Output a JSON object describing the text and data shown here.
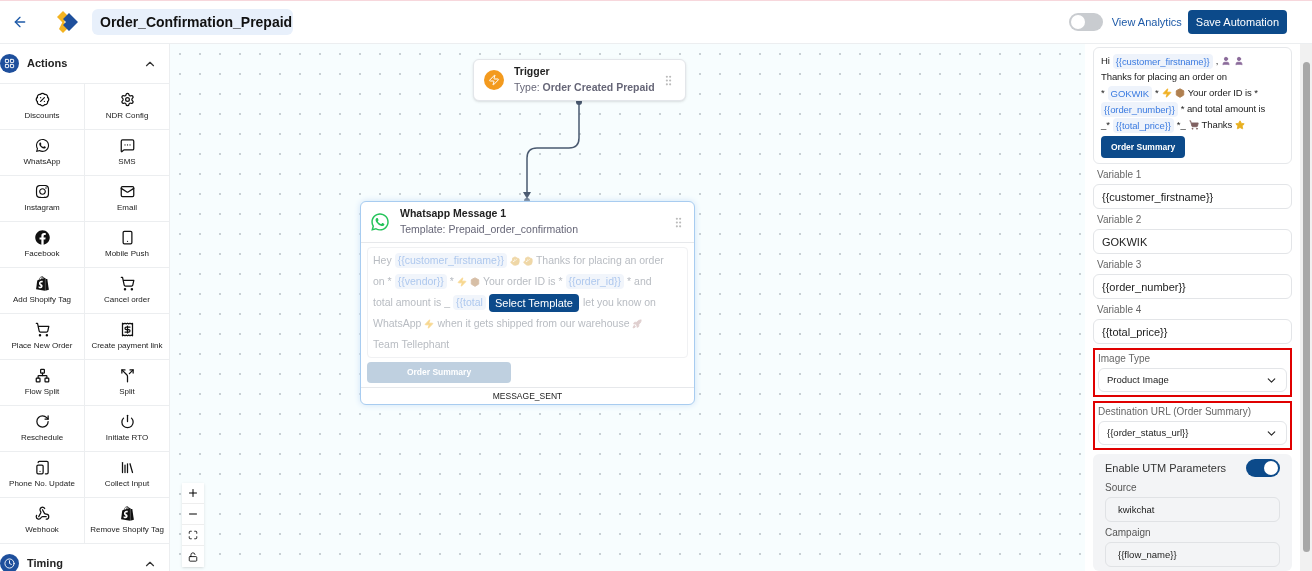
{
  "header": {
    "title": "Order_Confirmation_Prepaid",
    "analytics": {
      "label": "View Analytics",
      "on": false
    },
    "save_button": "Save Automation"
  },
  "sidebar": {
    "sections": [
      {
        "title": "Actions",
        "expanded": true,
        "items": [
          "Discounts",
          "NDR Config",
          "WhatsApp",
          "SMS",
          "Instagram",
          "Email",
          "Facebook",
          "Mobile Push",
          "Add Shopify Tag",
          "Cancel order",
          "Place New Order",
          "Create payment link",
          "Flow Split",
          "Split",
          "Reschedule",
          "Initiate RTO",
          "Phone No. Update",
          "Collect Input",
          "Webhook",
          "Remove Shopify Tag"
        ]
      },
      {
        "title": "Timing",
        "expanded": true
      }
    ]
  },
  "canvas": {
    "trigger": {
      "title": "Trigger",
      "subtitle": "Type: **Order Created Prepaid**"
    },
    "message_node": {
      "title": "Whatsapp Message 1",
      "subtitle": "Template: Prepaid_order_confirmation",
      "message": [
        [
          {
            "kind": "text",
            "text": "Hey"
          },
          {
            "kind": "var",
            "text": "{{customer_firstname}}"
          },
          {
            "kind": "icon"
          },
          {
            "kind": "icon"
          },
          {
            "kind": "text",
            "text": "Thanks for placing an order"
          }
        ],
        [
          {
            "kind": "text",
            "text": "on *"
          },
          {
            "kind": "var",
            "text": "{{vendor}}"
          },
          {
            "kind": "text",
            "text": "*"
          },
          {
            "kind": "icon"
          },
          {
            "kind": "icon"
          },
          {
            "kind": "text",
            "text": "Your order ID is *"
          },
          {
            "kind": "var",
            "text": "{{order_id}}"
          },
          {
            "kind": "text",
            "text": "* and"
          }
        ],
        [
          {
            "kind": "text",
            "text": "total amount is _"
          },
          {
            "kind": "var",
            "text": "{{total"
          },
          {
            "kind": "button",
            "text": "Select Template"
          },
          {
            "kind": "text",
            "text": "let you know on"
          }
        ],
        [
          {
            "kind": "text",
            "text": "WhatsApp"
          },
          {
            "kind": "icon"
          },
          {
            "kind": "text",
            "text": "when it gets shipped from our warehouse"
          },
          {
            "kind": "icon"
          }
        ],
        [
          {
            "kind": "text",
            "text": "Team Tellephant"
          }
        ]
      ],
      "button": {
        "label": "Order Summary",
        "disabled": true
      },
      "output": "MESSAGE_SENT"
    }
  },
  "panel": {
    "preview": [
      [
        {
          "kind": "text",
          "text": "Hi"
        },
        {
          "kind": "var",
          "text": "{{customer_firstname}}"
        },
        {
          "kind": "text",
          "text": ","
        },
        {
          "kind": "icon"
        },
        {
          "kind": "icon"
        }
      ],
      [
        {
          "kind": "text",
          "text": "Thanks for placing an order on"
        }
      ],
      [
        {
          "kind": "text",
          "text": "*"
        },
        {
          "kind": "var",
          "text": "GOKWIK"
        },
        {
          "kind": "text",
          "text": "*"
        },
        {
          "kind": "icon"
        },
        {
          "kind": "icon"
        },
        {
          "kind": "text",
          "text": "Your order ID is *"
        }
      ],
      [
        {
          "kind": "var",
          "text": "{{order_number}}"
        },
        {
          "kind": "text",
          "text": "* and total amount is"
        }
      ],
      [
        {
          "kind": "text",
          "text": "_*"
        },
        {
          "kind": "var",
          "text": "{{total_price}}"
        },
        {
          "kind": "text",
          "text": "*_"
        },
        {
          "kind": "icon"
        },
        {
          "kind": "text",
          "text": "Thanks"
        },
        {
          "kind": "icon"
        }
      ]
    ],
    "preview_button": "Order Summary",
    "variables": [
      {
        "label": "Variable 1",
        "value": "{{customer_firstname}}"
      },
      {
        "label": "Variable 2",
        "value": "GOKWIK"
      },
      {
        "label": "Variable 3",
        "value": "{{order_number}}"
      },
      {
        "label": "Variable 4",
        "value": "{{total_price}}"
      }
    ],
    "selects": [
      {
        "label": "Image Type",
        "value": "Product Image",
        "highlighted": true
      },
      {
        "label": "Destination URL (Order Summary)",
        "value": "{{order_status_url}}",
        "highlighted": true
      }
    ],
    "utm": {
      "label": "Enable UTM Parameters",
      "on": true,
      "fields": [
        {
          "label": "Source",
          "value": "kwikchat"
        },
        {
          "label": "Campaign",
          "value": "{{flow_name}}"
        }
      ]
    }
  }
}
